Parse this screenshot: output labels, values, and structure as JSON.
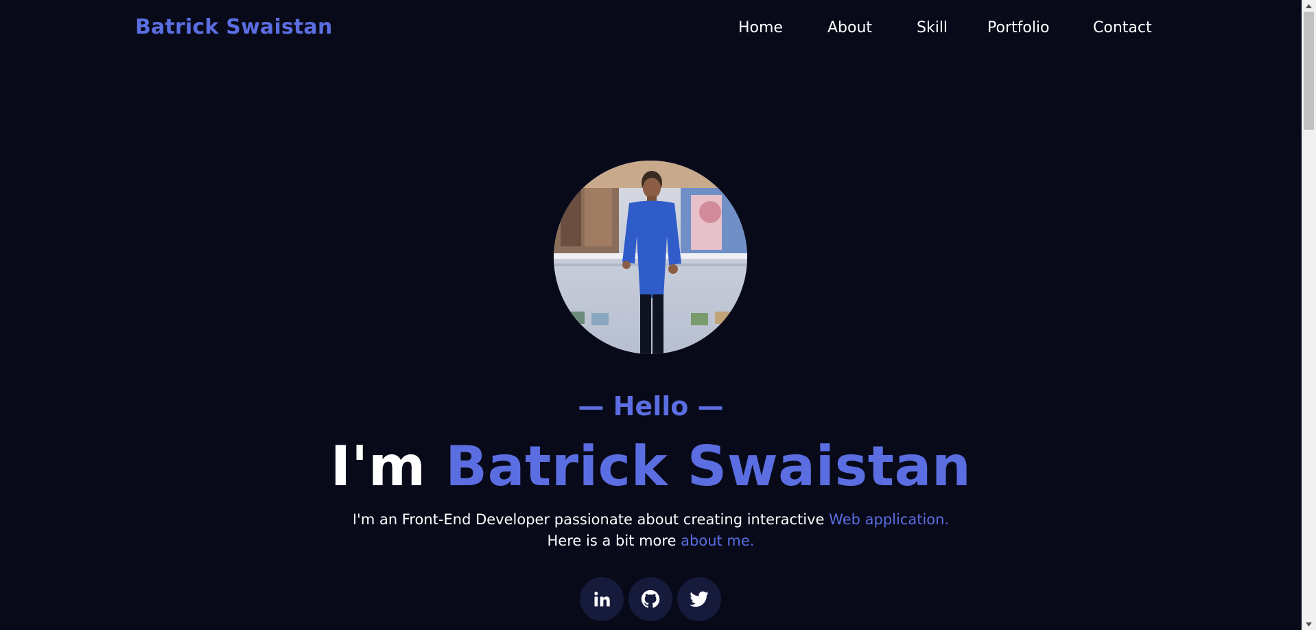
{
  "brand": {
    "name": "Batrick Swaistan"
  },
  "nav": {
    "items": [
      {
        "label": "Home"
      },
      {
        "label": "About"
      },
      {
        "label": "Skill"
      },
      {
        "label": "Portfolio"
      },
      {
        "label": "Contact"
      }
    ]
  },
  "hero": {
    "photo_alt": "profile-photo",
    "hello": "— Hello —",
    "headline_prefix": "I'm",
    "headline_name": "Batrick Swaistan",
    "intro_line1_text": "I'm an Front-End Developer passionate about creating interactive",
    "intro_line1_link": "Web application.",
    "intro_line2_text": "Here is a bit more",
    "intro_line2_link": "about me."
  },
  "socials": [
    {
      "name": "linkedin-icon"
    },
    {
      "name": "github-icon"
    },
    {
      "name": "twitter-icon"
    }
  ],
  "colors": {
    "background": "#080a1a",
    "accent": "#5b6ee1",
    "text": "#ffffff",
    "social_bg": "#161a3b"
  }
}
